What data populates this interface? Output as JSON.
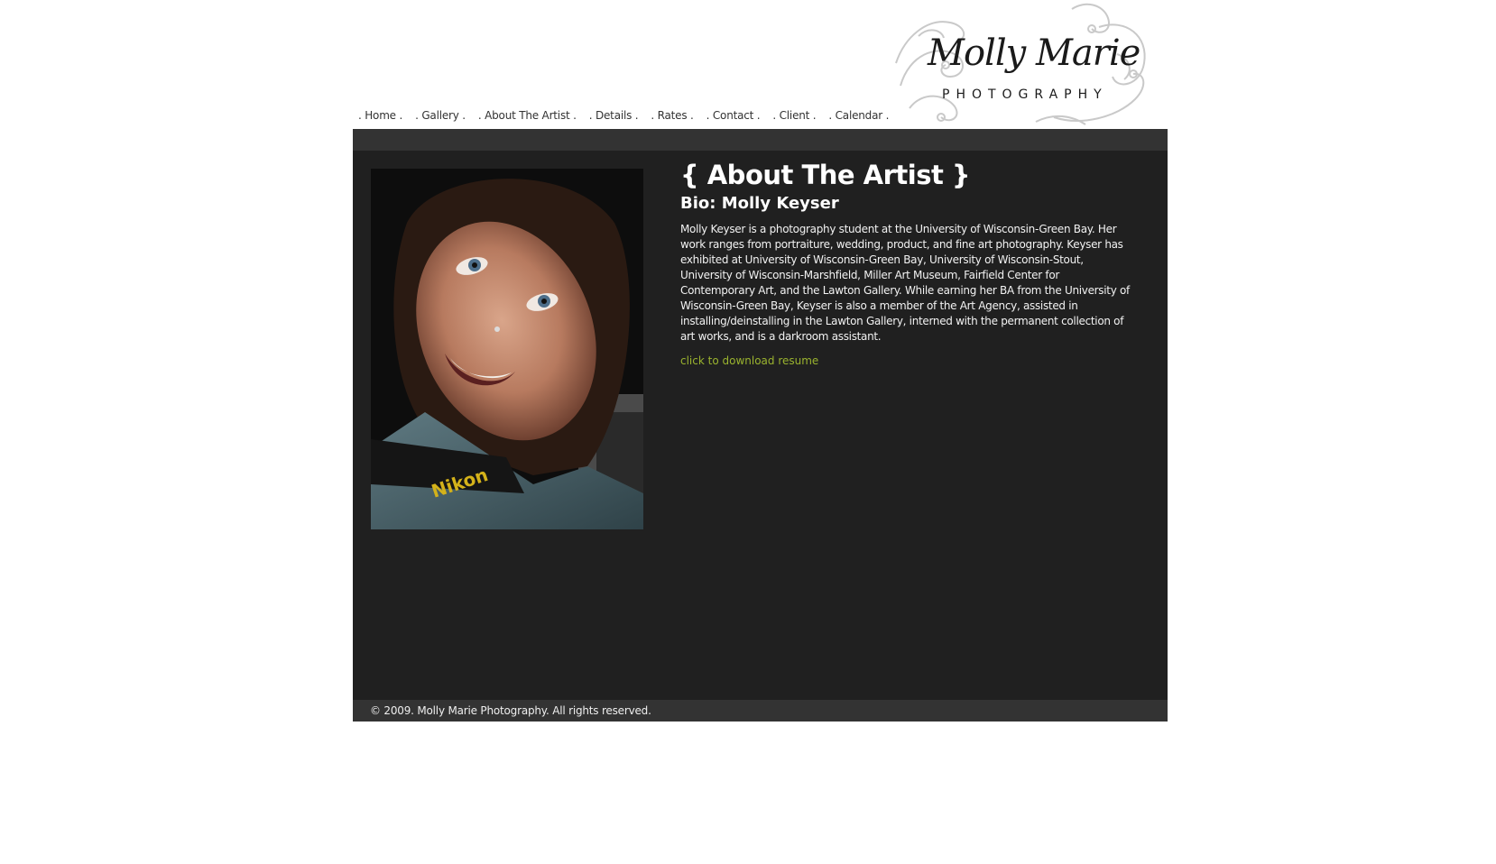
{
  "nav": {
    "items": [
      {
        "label": ". Home ."
      },
      {
        "label": ". Gallery ."
      },
      {
        "label": ". About The Artist ."
      },
      {
        "label": ". Details ."
      },
      {
        "label": ". Rates ."
      },
      {
        "label": ". Contact ."
      },
      {
        "label": ". Client ."
      },
      {
        "label": ". Calendar ."
      }
    ]
  },
  "logo": {
    "script": "Molly Marie",
    "sub": "PHOTOGRAPHY"
  },
  "main": {
    "title": "{ About The Artist }",
    "bio_title": "Bio: Molly Keyser",
    "bio_text": "Molly Keyser is a photography student at the University of Wisconsin-Green Bay. Her work ranges from portraiture, wedding, product, and fine art photography. Keyser has exhibited at University of Wisconsin-Green Bay, University of Wisconsin-Stout, University of Wisconsin-Marshfield, Miller Art Museum, Fairfield Center for Contemporary Art, and the Lawton Gallery. While earning her BA from the University of Wisconsin-Green Bay, Keyser is also a member of the Art Agency, assisted in installing/deinstalling in the Lawton Gallery, interned with the permanent collection of art works, and is a darkroom assistant.",
    "resume_link": "click to download resume",
    "photo_strap_text": "Nikon"
  },
  "footer": {
    "copyright": "© 2009. Molly Marie Photography. All rights reserved."
  },
  "colors": {
    "content_bg": "#202020",
    "bar_bg": "#333333",
    "link_green": "#9ab32e"
  }
}
